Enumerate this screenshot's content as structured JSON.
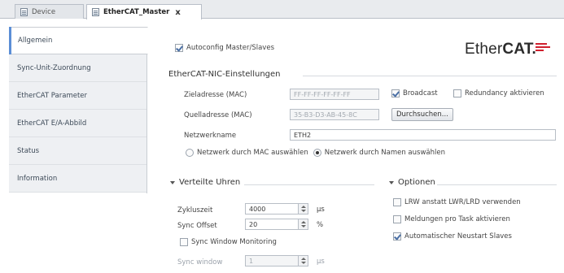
{
  "tabs": [
    {
      "label": "Device"
    },
    {
      "label": "EtherCAT_Master",
      "close": "x"
    }
  ],
  "sidenav": {
    "items": [
      {
        "label": "Allgemein"
      },
      {
        "label": "Sync-Unit-Zuordnung"
      },
      {
        "label": "EtherCAT Parameter"
      },
      {
        "label": "EtherCAT E/A-Abbild"
      },
      {
        "label": "Status"
      },
      {
        "label": "Information"
      }
    ]
  },
  "autoconfig": {
    "label": "Autoconfig Master/Slaves",
    "checked": true
  },
  "logo": {
    "text_plain": "Ether",
    "text_bold": "CAT."
  },
  "nic": {
    "title": "EtherCAT-NIC-Einstellungen",
    "ziel_label": "Zieladresse (MAC)",
    "ziel_value": "FF-FF-FF-FF-FF-FF",
    "broadcast_label": "Broadcast",
    "broadcast_checked": true,
    "redundancy_label": "Redundancy aktivieren",
    "redundancy_checked": false,
    "quell_label": "Quelladresse (MAC)",
    "quell_value": "35-B3-D3-AB-45-8C",
    "durchsuchen_label": "Durchsuchen...",
    "netzwerkname_label": "Netzwerkname",
    "netzwerkname_value": "ETH2",
    "radio_mac_label": "Netzwerk durch MAC auswählen",
    "radio_name_label": "Netzwerk durch Namen auswählen",
    "selected_radio": "name"
  },
  "uhren": {
    "title": "Verteilte Uhren",
    "zykluszeit_label": "Zykluszeit",
    "zykluszeit_value": "4000",
    "zykluszeit_unit": "µs",
    "sync_offset_label": "Sync Offset",
    "sync_offset_value": "20",
    "sync_offset_unit": "%",
    "sync_window_monitoring_label": "Sync Window Monitoring",
    "sync_window_monitoring_checked": false,
    "sync_window_label": "Sync window",
    "sync_window_value": "1",
    "sync_window_unit": "µs"
  },
  "optionen": {
    "title": "Optionen",
    "items": [
      {
        "label": "LRW anstatt LWR/LRD verwenden",
        "checked": false
      },
      {
        "label": "Meldungen pro Task aktivieren",
        "checked": false
      },
      {
        "label": "Automatischer Neustart Slaves",
        "checked": true
      }
    ]
  },
  "colors": {
    "accent": "#5b8ed6",
    "logo_red": "#d0202e"
  }
}
